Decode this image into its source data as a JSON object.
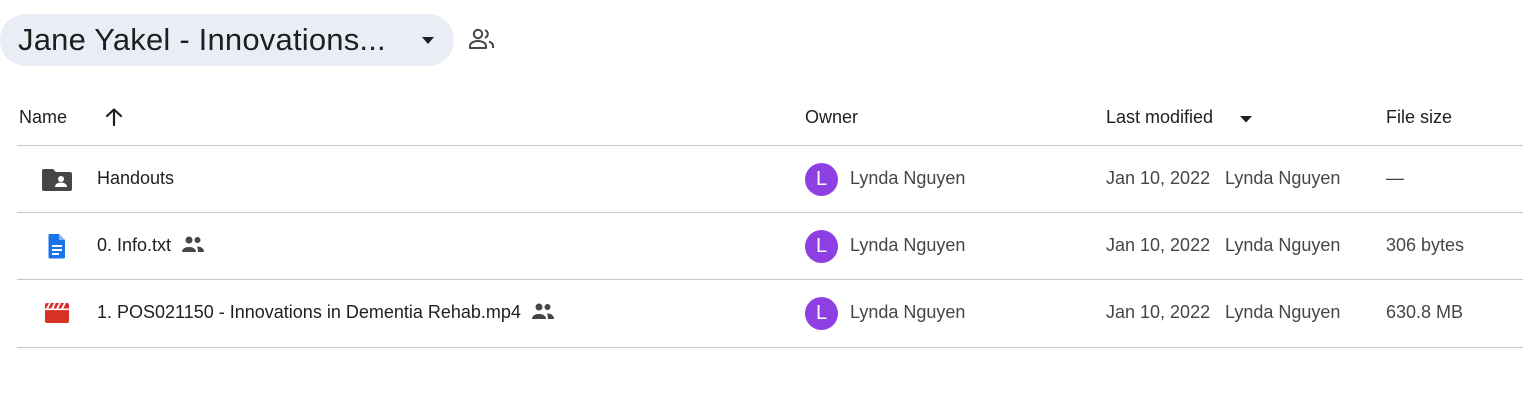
{
  "folder": {
    "title": "Jane Yakel - Innovations...",
    "caret_icon": "arrow-drop-down-icon",
    "share_icon": "people-outline-icon"
  },
  "columns": {
    "name": "Name",
    "owner": "Owner",
    "last_modified": "Last modified",
    "file_size": "File size",
    "sort_icon": "arrow-up-icon",
    "sort_direction": "ascending"
  },
  "files": [
    {
      "name": "Handouts",
      "icon": "shared-folder-icon",
      "icon_color": "#444746",
      "shared": false,
      "owner_initial": "L",
      "owner": "Lynda Nguyen",
      "modified_date": "Jan 10, 2022",
      "modified_by": "Lynda Nguyen",
      "size": "—"
    },
    {
      "name": "0. Info.txt",
      "icon": "document-icon",
      "icon_color": "#1a73e8",
      "shared": true,
      "owner_initial": "L",
      "owner": "Lynda Nguyen",
      "modified_date": "Jan 10, 2022",
      "modified_by": "Lynda Nguyen",
      "size": "306 bytes"
    },
    {
      "name": "1. POS021150 - Innovations in Dementia Rehab.mp4",
      "icon": "video-icon",
      "icon_color": "#d93025",
      "shared": true,
      "owner_initial": "L",
      "owner": "Lynda Nguyen",
      "modified_date": "Jan 10, 2022",
      "modified_by": "Lynda Nguyen",
      "size": "630.8 MB"
    }
  ],
  "colors": {
    "chip_bg": "#e9eef6",
    "avatar": "#8d3fe3",
    "divider": "#c7c7c7",
    "text": "#1f1f1f",
    "muted": "#444746"
  }
}
